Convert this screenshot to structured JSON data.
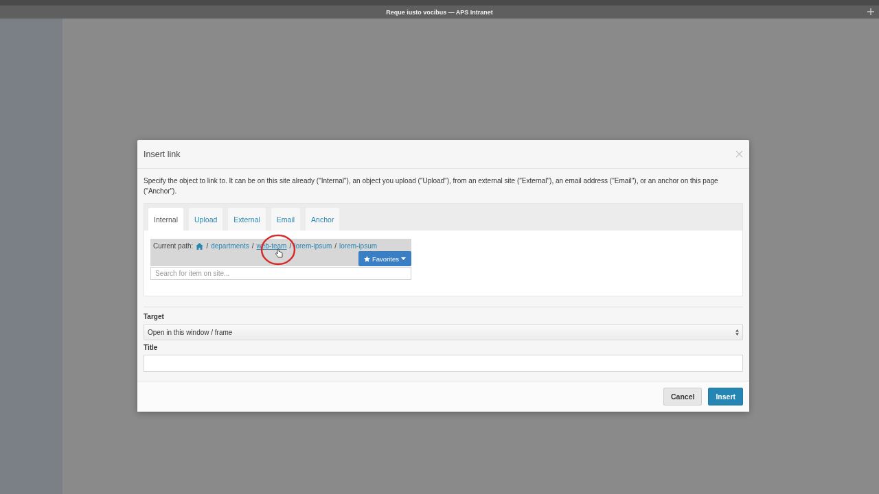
{
  "window": {
    "title": "Reque iusto vocibus — APS Intranet"
  },
  "dialog": {
    "title": "Insert link",
    "description": "Specify the object to link to. It can be on this site already (\"Internal\"), an object you upload (\"Upload\"), from an external site (\"External\"), an email address (\"Email\"), or an anchor on this page (\"Anchor\").",
    "tabs": [
      {
        "label": "Internal",
        "selected": true
      },
      {
        "label": "Upload",
        "selected": false
      },
      {
        "label": "External",
        "selected": false
      },
      {
        "label": "Email",
        "selected": false
      },
      {
        "label": "Anchor",
        "selected": false
      }
    ],
    "current_path": {
      "label": "Current path:",
      "separator": "/",
      "crumbs": [
        {
          "label": "departments",
          "hovered": false
        },
        {
          "label": "web-team",
          "hovered": true
        },
        {
          "label": "lorem-ipsum",
          "hovered": false
        },
        {
          "label": "lorem-ipsum",
          "hovered": false
        }
      ]
    },
    "favorites_button": "Favorites",
    "search": {
      "placeholder": "Search for item on site..."
    },
    "target": {
      "label": "Target",
      "value": "Open in this window / frame"
    },
    "title_field": {
      "label": "Title"
    },
    "buttons": [
      {
        "label": "Cancel",
        "kind": "secondary"
      },
      {
        "label": "Insert",
        "kind": "primary"
      }
    ]
  }
}
